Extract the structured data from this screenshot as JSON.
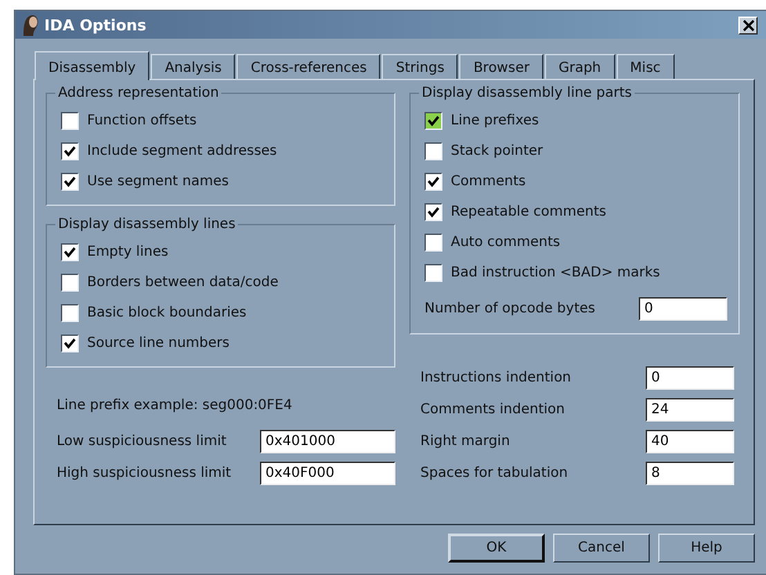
{
  "window": {
    "title": "IDA Options"
  },
  "tabs": [
    {
      "label": "Disassembly",
      "selected": true
    },
    {
      "label": "Analysis",
      "selected": false
    },
    {
      "label": "Cross-references",
      "selected": false
    },
    {
      "label": "Strings",
      "selected": false
    },
    {
      "label": "Browser",
      "selected": false
    },
    {
      "label": "Graph",
      "selected": false
    },
    {
      "label": "Misc",
      "selected": false
    }
  ],
  "address_representation": {
    "title": "Address representation",
    "options": [
      {
        "label": "Function offsets",
        "checked": false,
        "color": "#ffffff"
      },
      {
        "label": "Include segment addresses",
        "checked": true,
        "color": "#ffffff"
      },
      {
        "label": "Use segment names",
        "checked": true,
        "color": "#ffffff"
      }
    ]
  },
  "display_lines": {
    "title": "Display disassembly lines",
    "options": [
      {
        "label": "Empty lines",
        "checked": true,
        "color": "#ffffff"
      },
      {
        "label": "Borders between data/code",
        "checked": false,
        "color": "#ffffff"
      },
      {
        "label": "Basic block boundaries",
        "checked": false,
        "color": "#ffffff"
      },
      {
        "label": "Source line numbers",
        "checked": true,
        "color": "#ffffff"
      }
    ]
  },
  "line_parts": {
    "title": "Display disassembly line parts",
    "options": [
      {
        "label": "Line prefixes",
        "checked": true,
        "color": "#8bd04a"
      },
      {
        "label": "Stack pointer",
        "checked": false,
        "color": "#ffffff"
      },
      {
        "label": "Comments",
        "checked": true,
        "color": "#ffffff"
      },
      {
        "label": "Repeatable comments",
        "checked": true,
        "color": "#ffffff"
      },
      {
        "label": "Auto comments",
        "checked": false,
        "color": "#ffffff"
      },
      {
        "label": "Bad instruction <BAD> marks",
        "checked": false,
        "color": "#ffffff"
      }
    ],
    "field": {
      "label": "Number of opcode bytes",
      "value": "0"
    }
  },
  "line_prefix_example": "Line prefix example: seg000:0FE4",
  "left_fields": [
    {
      "label": "Low suspiciousness limit",
      "value": "0x401000"
    },
    {
      "label": "High suspiciousness limit",
      "value": "0x40F000"
    }
  ],
  "right_fields": [
    {
      "label": "Instructions indention",
      "value": "0"
    },
    {
      "label": "Comments indention",
      "value": "24"
    },
    {
      "label": "Right margin",
      "value": "40"
    },
    {
      "label": "Spaces for tabulation",
      "value": "8"
    }
  ],
  "buttons": [
    {
      "label": "OK",
      "default": true
    },
    {
      "label": "Cancel",
      "default": false
    },
    {
      "label": "Help",
      "default": false
    }
  ]
}
